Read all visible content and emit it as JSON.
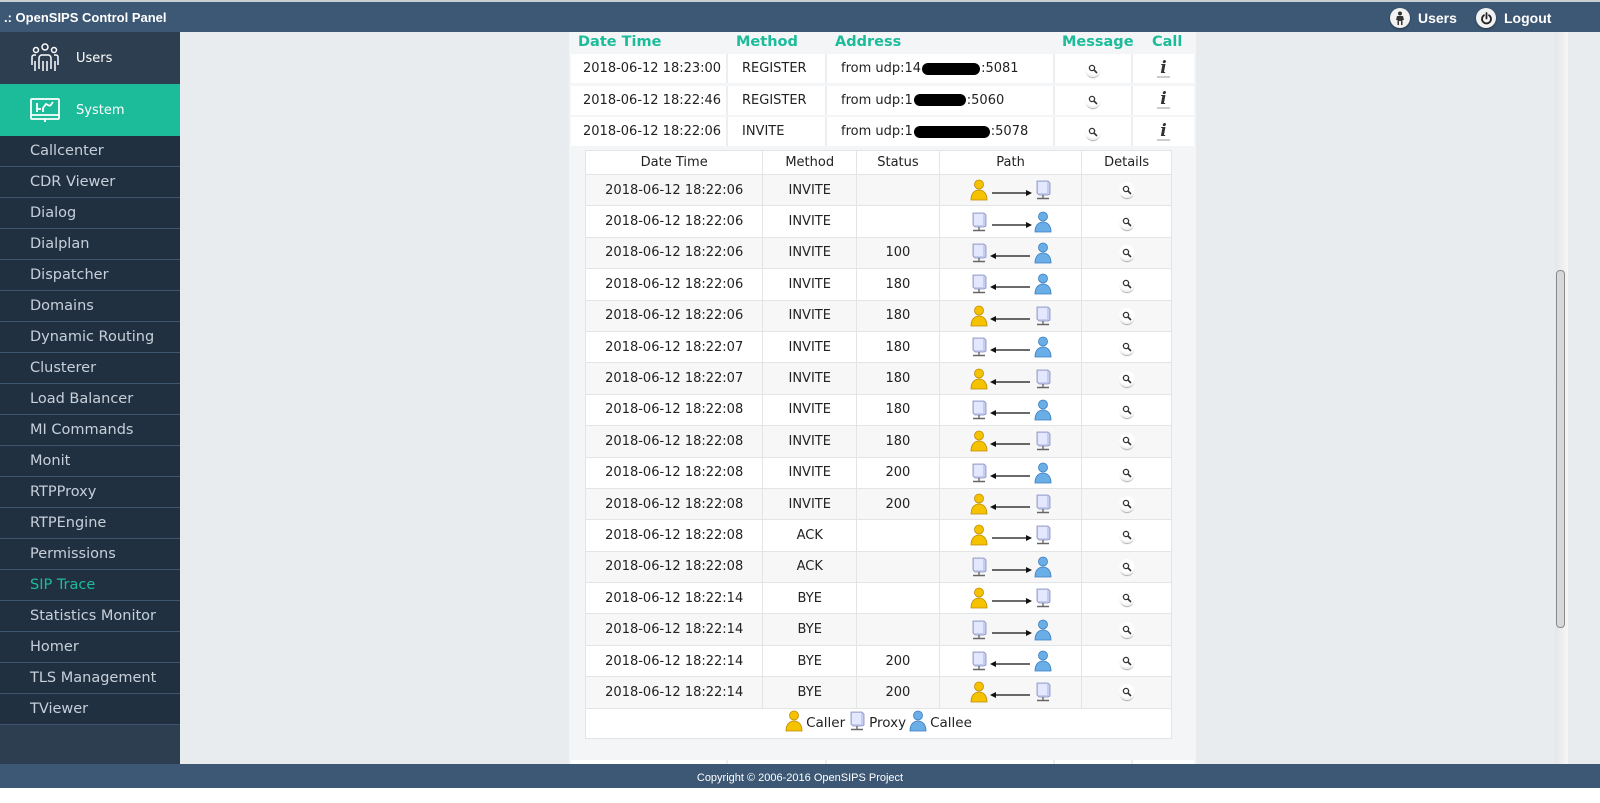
{
  "app": {
    "title": ".: OpenSIPS Control Panel",
    "users_link": "Users",
    "logout_link": "Logout",
    "footer": "Copyright © 2006-2016 OpenSIPS Project"
  },
  "sidebar": {
    "modules": [
      {
        "label": "Users",
        "icon": "users-group-icon",
        "active": false
      },
      {
        "label": "System",
        "icon": "system-monitor-icon",
        "active": true
      }
    ],
    "items": [
      {
        "label": "Callcenter"
      },
      {
        "label": "CDR Viewer"
      },
      {
        "label": "Dialog"
      },
      {
        "label": "Dialplan"
      },
      {
        "label": "Dispatcher"
      },
      {
        "label": "Domains"
      },
      {
        "label": "Dynamic Routing"
      },
      {
        "label": "Clusterer"
      },
      {
        "label": "Load Balancer"
      },
      {
        "label": "MI Commands"
      },
      {
        "label": "Monit"
      },
      {
        "label": "RTPProxy"
      },
      {
        "label": "RTPEngine"
      },
      {
        "label": "Permissions"
      },
      {
        "label": "SIP Trace",
        "active": true
      },
      {
        "label": "Statistics Monitor"
      },
      {
        "label": "Homer"
      },
      {
        "label": "TLS Management"
      },
      {
        "label": "TViewer"
      }
    ]
  },
  "trace": {
    "columns": {
      "datetime": "Date Time",
      "method": "Method",
      "address": "Address",
      "message": "Message",
      "call": "Call"
    },
    "rows": [
      {
        "datetime": "2018-06-12 18:23:00",
        "method": "REGISTER",
        "addr_prefix": "from udp:14",
        "addr_suffix": ":5081"
      },
      {
        "datetime": "2018-06-12 18:22:46",
        "method": "REGISTER",
        "addr_prefix": "from udp:1",
        "addr_suffix": ":5060"
      },
      {
        "datetime": "2018-06-12 18:22:06",
        "method": "INVITE",
        "addr_prefix": "from udp:1",
        "addr_suffix": ":5078"
      }
    ]
  },
  "call_flow": {
    "columns": {
      "datetime": "Date Time",
      "method": "Method",
      "status": "Status",
      "path": "Path",
      "details": "Details"
    },
    "rows": [
      {
        "datetime": "2018-06-12 18:22:06",
        "method": "INVITE",
        "status": "",
        "left": "caller",
        "right": "proxy",
        "dir": "right"
      },
      {
        "datetime": "2018-06-12 18:22:06",
        "method": "INVITE",
        "status": "",
        "left": "proxy",
        "right": "callee",
        "dir": "right"
      },
      {
        "datetime": "2018-06-12 18:22:06",
        "method": "INVITE",
        "status": "100",
        "left": "proxy",
        "right": "callee",
        "dir": "left"
      },
      {
        "datetime": "2018-06-12 18:22:06",
        "method": "INVITE",
        "status": "180",
        "left": "proxy",
        "right": "callee",
        "dir": "left"
      },
      {
        "datetime": "2018-06-12 18:22:06",
        "method": "INVITE",
        "status": "180",
        "left": "caller",
        "right": "proxy",
        "dir": "left"
      },
      {
        "datetime": "2018-06-12 18:22:07",
        "method": "INVITE",
        "status": "180",
        "left": "proxy",
        "right": "callee",
        "dir": "left"
      },
      {
        "datetime": "2018-06-12 18:22:07",
        "method": "INVITE",
        "status": "180",
        "left": "caller",
        "right": "proxy",
        "dir": "left"
      },
      {
        "datetime": "2018-06-12 18:22:08",
        "method": "INVITE",
        "status": "180",
        "left": "proxy",
        "right": "callee",
        "dir": "left"
      },
      {
        "datetime": "2018-06-12 18:22:08",
        "method": "INVITE",
        "status": "180",
        "left": "caller",
        "right": "proxy",
        "dir": "left"
      },
      {
        "datetime": "2018-06-12 18:22:08",
        "method": "INVITE",
        "status": "200",
        "left": "proxy",
        "right": "callee",
        "dir": "left"
      },
      {
        "datetime": "2018-06-12 18:22:08",
        "method": "INVITE",
        "status": "200",
        "left": "caller",
        "right": "proxy",
        "dir": "left"
      },
      {
        "datetime": "2018-06-12 18:22:08",
        "method": "ACK",
        "status": "",
        "left": "caller",
        "right": "proxy",
        "dir": "right"
      },
      {
        "datetime": "2018-06-12 18:22:08",
        "method": "ACK",
        "status": "",
        "left": "proxy",
        "right": "callee",
        "dir": "right"
      },
      {
        "datetime": "2018-06-12 18:22:14",
        "method": "BYE",
        "status": "",
        "left": "caller",
        "right": "proxy",
        "dir": "right"
      },
      {
        "datetime": "2018-06-12 18:22:14",
        "method": "BYE",
        "status": "",
        "left": "proxy",
        "right": "callee",
        "dir": "right"
      },
      {
        "datetime": "2018-06-12 18:22:14",
        "method": "BYE",
        "status": "200",
        "left": "proxy",
        "right": "callee",
        "dir": "left"
      },
      {
        "datetime": "2018-06-12 18:22:14",
        "method": "BYE",
        "status": "200",
        "left": "caller",
        "right": "proxy",
        "dir": "left"
      }
    ],
    "legend": {
      "caller": "Caller",
      "proxy": "Proxy",
      "callee": "Callee"
    }
  },
  "colors": {
    "accent": "#1cbc9b",
    "header": "#3d5874",
    "sidebar": "#213040",
    "caller": "#f5c200",
    "callee": "#6aaee8",
    "proxy": "#b8c4ee"
  }
}
